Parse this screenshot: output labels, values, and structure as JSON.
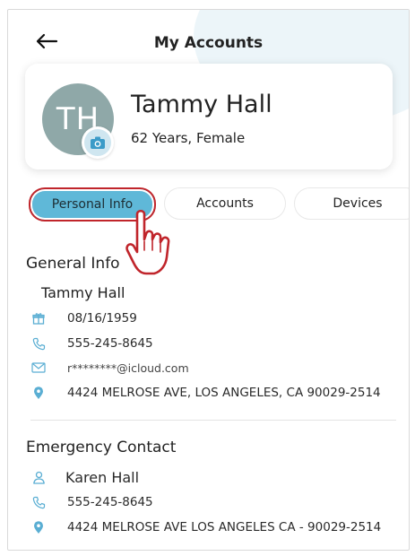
{
  "header": {
    "title": "My Accounts"
  },
  "profile": {
    "initials": "TH",
    "name": "Tammy Hall",
    "meta": "62 Years, Female"
  },
  "tabs": [
    {
      "label": "Personal Info",
      "active": true
    },
    {
      "label": "Accounts",
      "active": false
    },
    {
      "label": "Devices",
      "active": false
    }
  ],
  "general": {
    "title": "General Info",
    "name": "Tammy Hall",
    "dob": "08/16/1959",
    "phone": "555-245-8645",
    "email": "r********@icloud.com",
    "address": "4424 MELROSE AVE, LOS ANGELES, CA 90029-2514"
  },
  "emergency": {
    "title": "Emergency Contact",
    "name": "Karen Hall",
    "phone": "555-245-8645",
    "address": "4424 MELROSE AVE LOS ANGELES CA - 90029-2514"
  },
  "icons": {
    "back": "arrow-left-icon",
    "camera": "camera-icon",
    "birthday": "gift-icon",
    "phone": "phone-icon",
    "email": "mail-icon",
    "location": "location-pin-icon",
    "person": "person-icon"
  },
  "colors": {
    "accent": "#5fb8d8",
    "highlight": "#c0252b",
    "icon": "#5aaed3",
    "avatar": "#8fa8a8"
  }
}
